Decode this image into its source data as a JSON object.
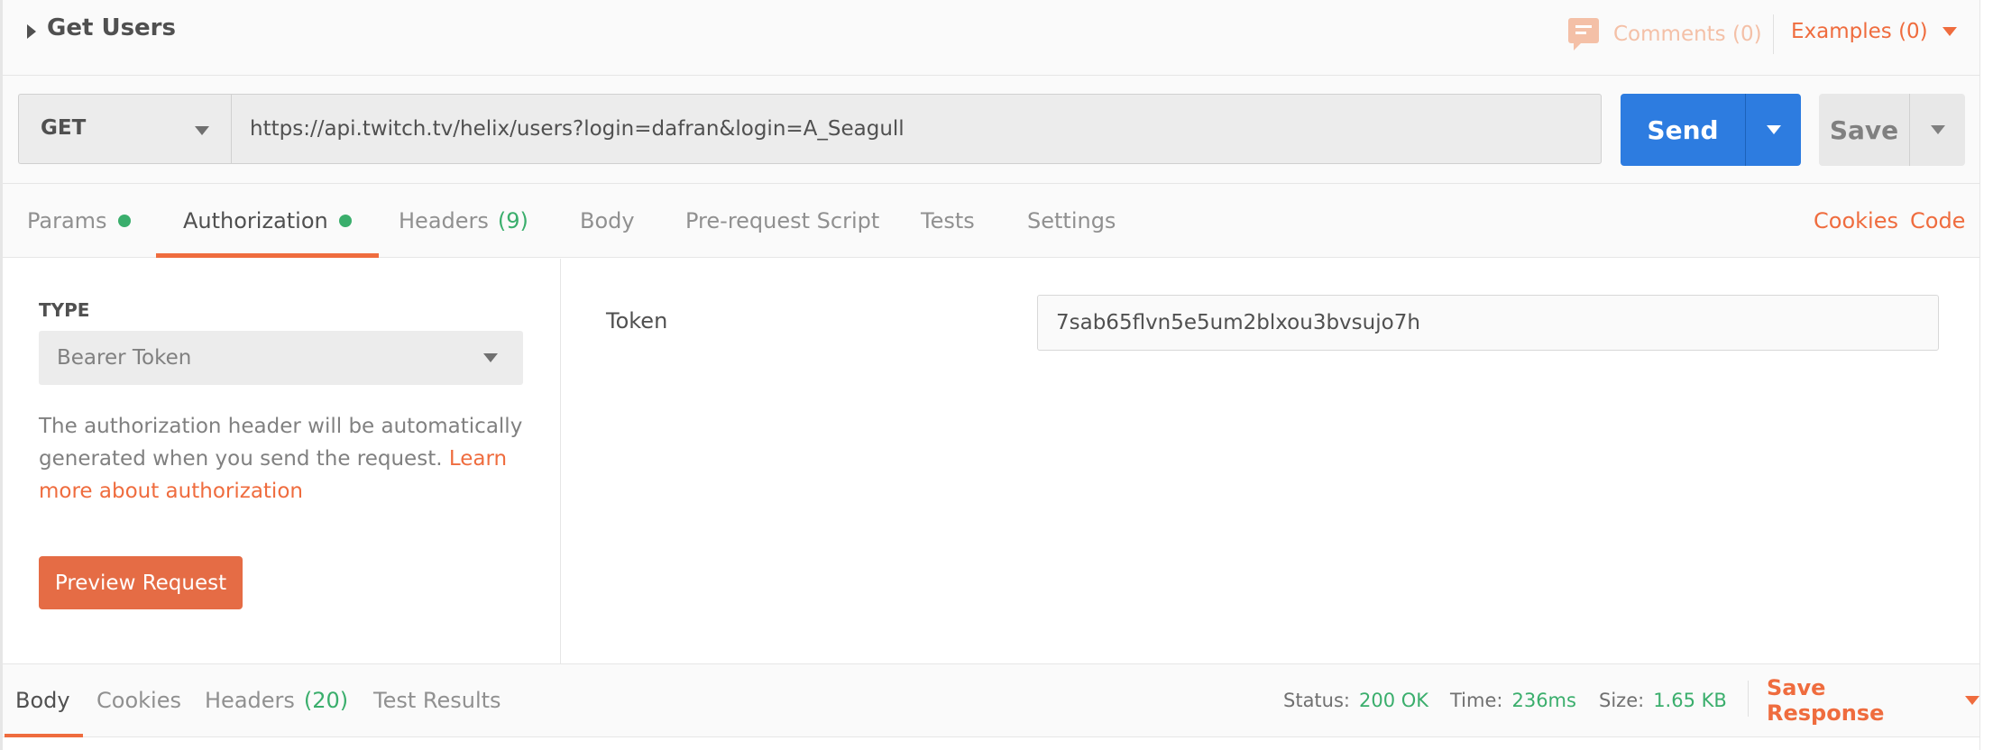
{
  "request": {
    "name": "Get Users",
    "comments_label": "Comments (0)",
    "examples_label": "Examples (0)",
    "method": "GET",
    "url": "https://api.twitch.tv/helix/users?login=dafran&login=A_Seagull",
    "send_label": "Send",
    "save_label": "Save"
  },
  "tabs": {
    "params": "Params",
    "authorization": "Authorization",
    "headers": "Headers",
    "headers_count": "(9)",
    "body": "Body",
    "prerequest": "Pre-request Script",
    "tests": "Tests",
    "settings": "Settings",
    "cookies": "Cookies",
    "code": "Code"
  },
  "auth": {
    "type_label": "TYPE",
    "type_value": "Bearer Token",
    "description": "The authorization header will be automatically generated when you send the request.",
    "learn_more": "Learn more about authorization",
    "preview_button": "Preview Request",
    "token_label": "Token",
    "token_value": "7sab65flvn5e5um2blxou3bvsujo7h"
  },
  "response": {
    "tabs": {
      "body": "Body",
      "cookies": "Cookies",
      "headers": "Headers",
      "headers_count": "(20)",
      "test_results": "Test Results"
    },
    "status_label": "Status:",
    "status_value": "200 OK",
    "time_label": "Time:",
    "time_value": "236ms",
    "size_label": "Size:",
    "size_value": "1.65 KB",
    "save_response": "Save Response"
  },
  "colors": {
    "accent": "#ef6c3e",
    "send_blue": "#2d7ce0",
    "success_green": "#3aae6c"
  },
  "icons": {
    "comments": "comment-bubble-icon",
    "caret": "caret-right-icon",
    "dropdown": "chevron-down-icon"
  }
}
